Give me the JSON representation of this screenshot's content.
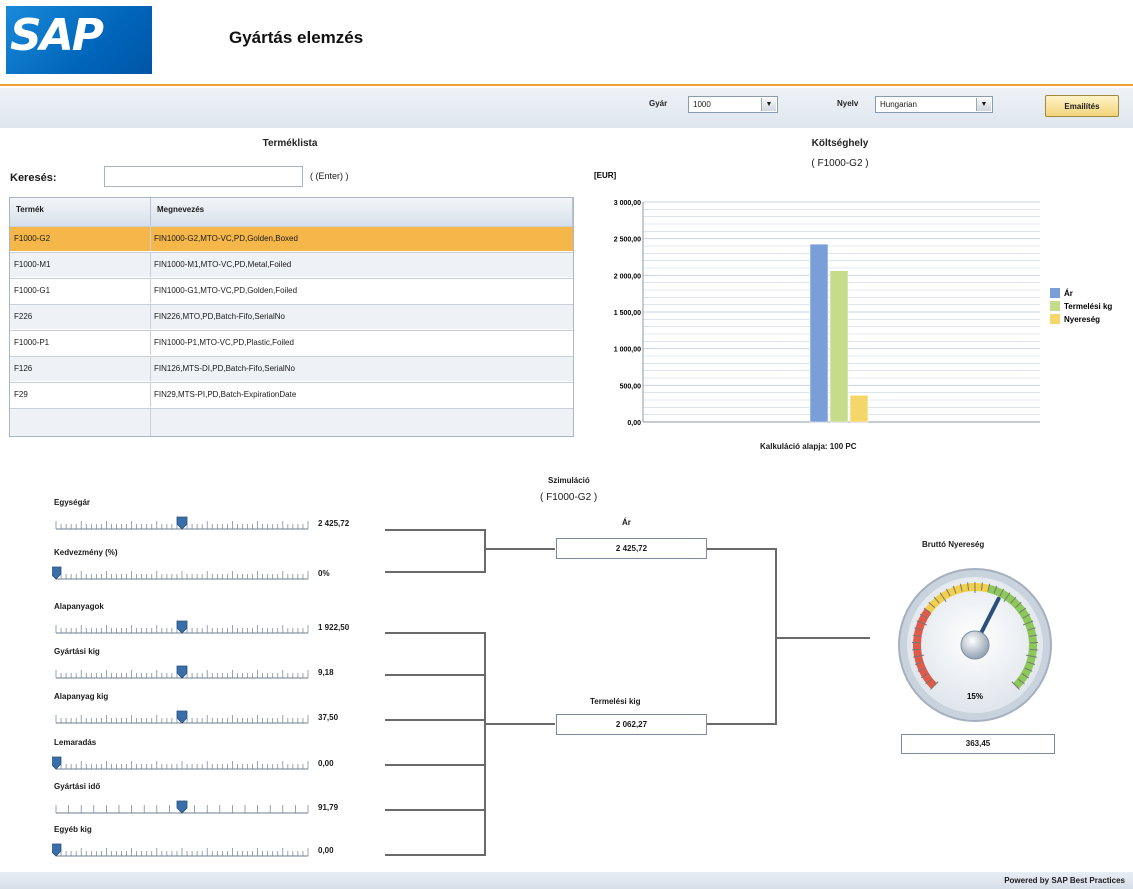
{
  "header": {
    "logo_text": "SAP",
    "title": "Gyártás elemzés"
  },
  "toolbar": {
    "plant_label": "Gyár",
    "plant_value": "1000",
    "lang_label": "Nyelv",
    "lang_value": "Hungarian",
    "settings_label": "Emailítés"
  },
  "products": {
    "title": "Terméklista",
    "search_label": "Keresés:",
    "search_value": "",
    "search_hint": "( (Enter) )",
    "columns": [
      "Termék",
      "Megnevezés"
    ],
    "rows": [
      {
        "product": "F1000-G2",
        "name": "FIN1000-G2,MTO-VC,PD,Golden,Boxed",
        "selected": true
      },
      {
        "product": "F1000-M1",
        "name": "FIN1000-M1,MTO-VC,PD,Metal,Foiled",
        "selected": false
      },
      {
        "product": "F1000-G1",
        "name": "FIN1000-G1,MTO-VC,PD,Golden,Foiled",
        "selected": false
      },
      {
        "product": "F226",
        "name": "FIN226,MTO,PD,Batch-Fifo,SerialNo",
        "selected": false
      },
      {
        "product": "F1000-P1",
        "name": "FIN1000-P1,MTO-VC,PD,Plastic,Foiled",
        "selected": false
      },
      {
        "product": "F126",
        "name": "FIN126,MTS-DI,PD,Batch-Fifo,SerialNo",
        "selected": false
      },
      {
        "product": "F29",
        "name": "FIN29,MTS-PI,PD,Batch-ExpirationDate",
        "selected": false
      }
    ]
  },
  "cost_center": {
    "title": "Költséghely",
    "subtitle": "( F1000-G2 )",
    "calc_base": "Kalkuláció alapja: 100 PC"
  },
  "chart_data": {
    "type": "bar",
    "ylabel": "[EUR]",
    "ylim": [
      0,
      3000
    ],
    "yticks": [
      "3 000,00",
      "2 500,00",
      "2 000,00",
      "1 500,00",
      "1 000,00",
      "500,00",
      "0,00"
    ],
    "tick_values": [
      3000,
      2500,
      2000,
      1500,
      1000,
      500,
      0
    ],
    "categories": [
      ""
    ],
    "series": [
      {
        "name": "Ár",
        "values": [
          2425.72
        ],
        "color": "#7a9fd8"
      },
      {
        "name": "Termelési kg",
        "values": [
          2062.27
        ],
        "color": "#c5dc8a"
      },
      {
        "name": "Nyereség",
        "values": [
          363.45
        ],
        "color": "#f5d66a"
      }
    ],
    "legend": "right",
    "grid": true
  },
  "simulation": {
    "title": "Szimuláció",
    "subtitle": "( F1000-G2 )",
    "price_label": "Ár",
    "price_value": "2 425,72",
    "prodcost_label": "Termelési kig",
    "prodcost_value": "2 062,27",
    "sliders": [
      {
        "label": "Egységár",
        "value": "2 425,72",
        "level": 0.5,
        "coarse": false
      },
      {
        "label": "Kedvezmény (%)",
        "value": "0%",
        "level": 0.0,
        "coarse": false
      },
      {
        "label": "Alapanyagok",
        "value": "1 922,50",
        "level": 0.5,
        "coarse": false
      },
      {
        "label": "Gyártási kig",
        "value": "9,18",
        "level": 0.5,
        "coarse": false
      },
      {
        "label": "Alapanyag kig",
        "value": "37,50",
        "level": 0.5,
        "coarse": false
      },
      {
        "label": "Lemaradás",
        "value": "0,00",
        "level": 0.0,
        "coarse": false
      },
      {
        "label": "Gyártási idő",
        "value": "91,79",
        "level": 0.5,
        "coarse": true
      },
      {
        "label": "Egyéb kig",
        "value": "0,00",
        "level": 0.0,
        "coarse": false
      }
    ]
  },
  "gross_profit": {
    "title": "Bruttó Nyereség",
    "percent_label": "15%",
    "percent": 15,
    "value": "363,45"
  },
  "footer": {
    "text": "Powered by SAP Best Practices"
  }
}
